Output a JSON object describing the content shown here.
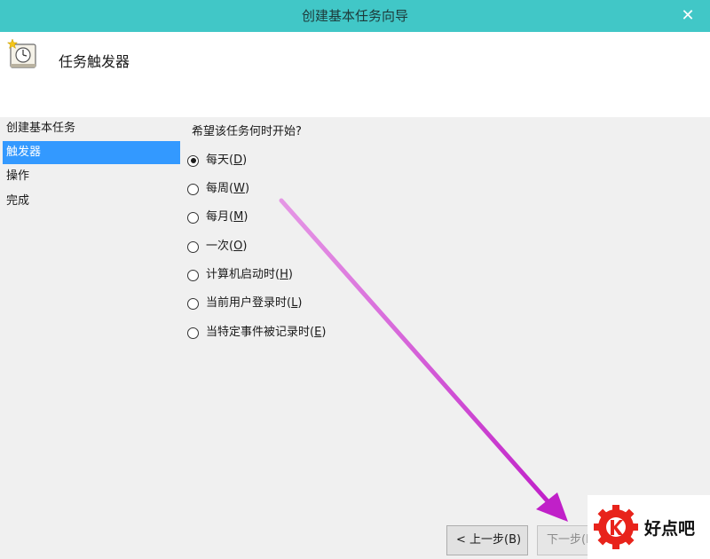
{
  "window": {
    "title": "创建基本任务向导",
    "close_glyph": "✕"
  },
  "header": {
    "title": "任务触发器",
    "icon": "clock-icon"
  },
  "nav": {
    "items": [
      {
        "label": "创建基本任务",
        "active": false
      },
      {
        "label": "触发器",
        "active": true
      },
      {
        "label": "操作",
        "active": false
      },
      {
        "label": "完成",
        "active": false
      }
    ]
  },
  "content": {
    "question": "希望该任务何时开始?",
    "selected": "daily",
    "options": [
      {
        "id": "daily",
        "text": "每天",
        "key": "D"
      },
      {
        "id": "weekly",
        "text": "每周",
        "key": "W"
      },
      {
        "id": "monthly",
        "text": "每月",
        "key": "M"
      },
      {
        "id": "once",
        "text": "一次",
        "key": "O"
      },
      {
        "id": "startup",
        "text": "计算机启动时",
        "key": "H"
      },
      {
        "id": "logon",
        "text": "当前用户登录时",
        "key": "L"
      },
      {
        "id": "event",
        "text": "当特定事件被记录时",
        "key": "E"
      }
    ]
  },
  "buttons": {
    "back": "< 上一步(B)",
    "next": "下一步(N)"
  },
  "annotation": {
    "color": "#d030d0"
  },
  "watermark": {
    "text": "好点吧",
    "logo_color": "#e8231b"
  },
  "colors": {
    "titlebar": "#41c7c7",
    "selection": "#3399ff"
  }
}
